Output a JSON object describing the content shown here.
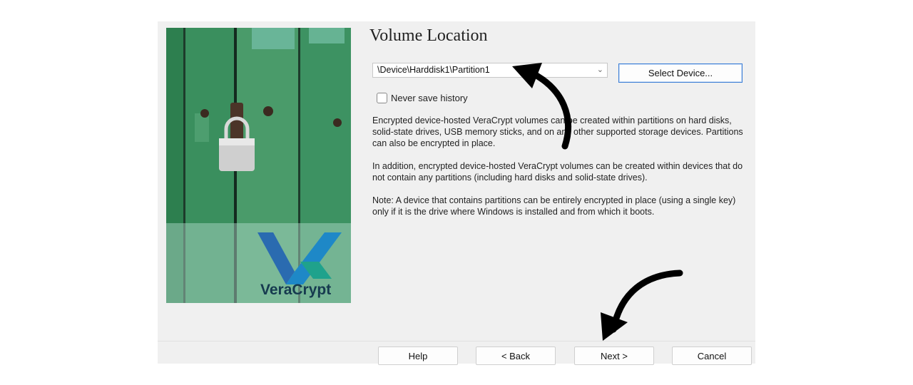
{
  "wizard": {
    "title": "Volume Location",
    "device_combo": {
      "value": "\\Device\\Harddisk1\\Partition1"
    },
    "select_device_label": "Select Device...",
    "never_save_history_label": "Never save history",
    "never_save_history_checked": false,
    "paragraphs": [
      "Encrypted device-hosted VeraCrypt volumes can be created within partitions on hard disks, solid-state drives, USB memory sticks, and on any other supported storage devices. Partitions can also be encrypted in place.",
      "In addition, encrypted device-hosted VeraCrypt volumes can be created within devices that do not contain any partitions (including hard disks and solid-state drives).",
      "Note: A device that contains partitions can be entirely encrypted in place (using a single key) only if it is the drive where Windows is installed and from which it boots."
    ],
    "brand_text": "VeraCrypt",
    "buttons": {
      "help": "Help",
      "back": "< Back",
      "next": "Next >",
      "cancel": "Cancel"
    }
  },
  "icons": {
    "combo_chevron": "chevron-down-icon",
    "logo": "veracrypt-logo-icon",
    "padlock": "padlock-icon"
  },
  "colors": {
    "dialog_bg": "#f0f0f0",
    "accent_border": "#3d7fd6",
    "door_green": "#2f7d52"
  }
}
